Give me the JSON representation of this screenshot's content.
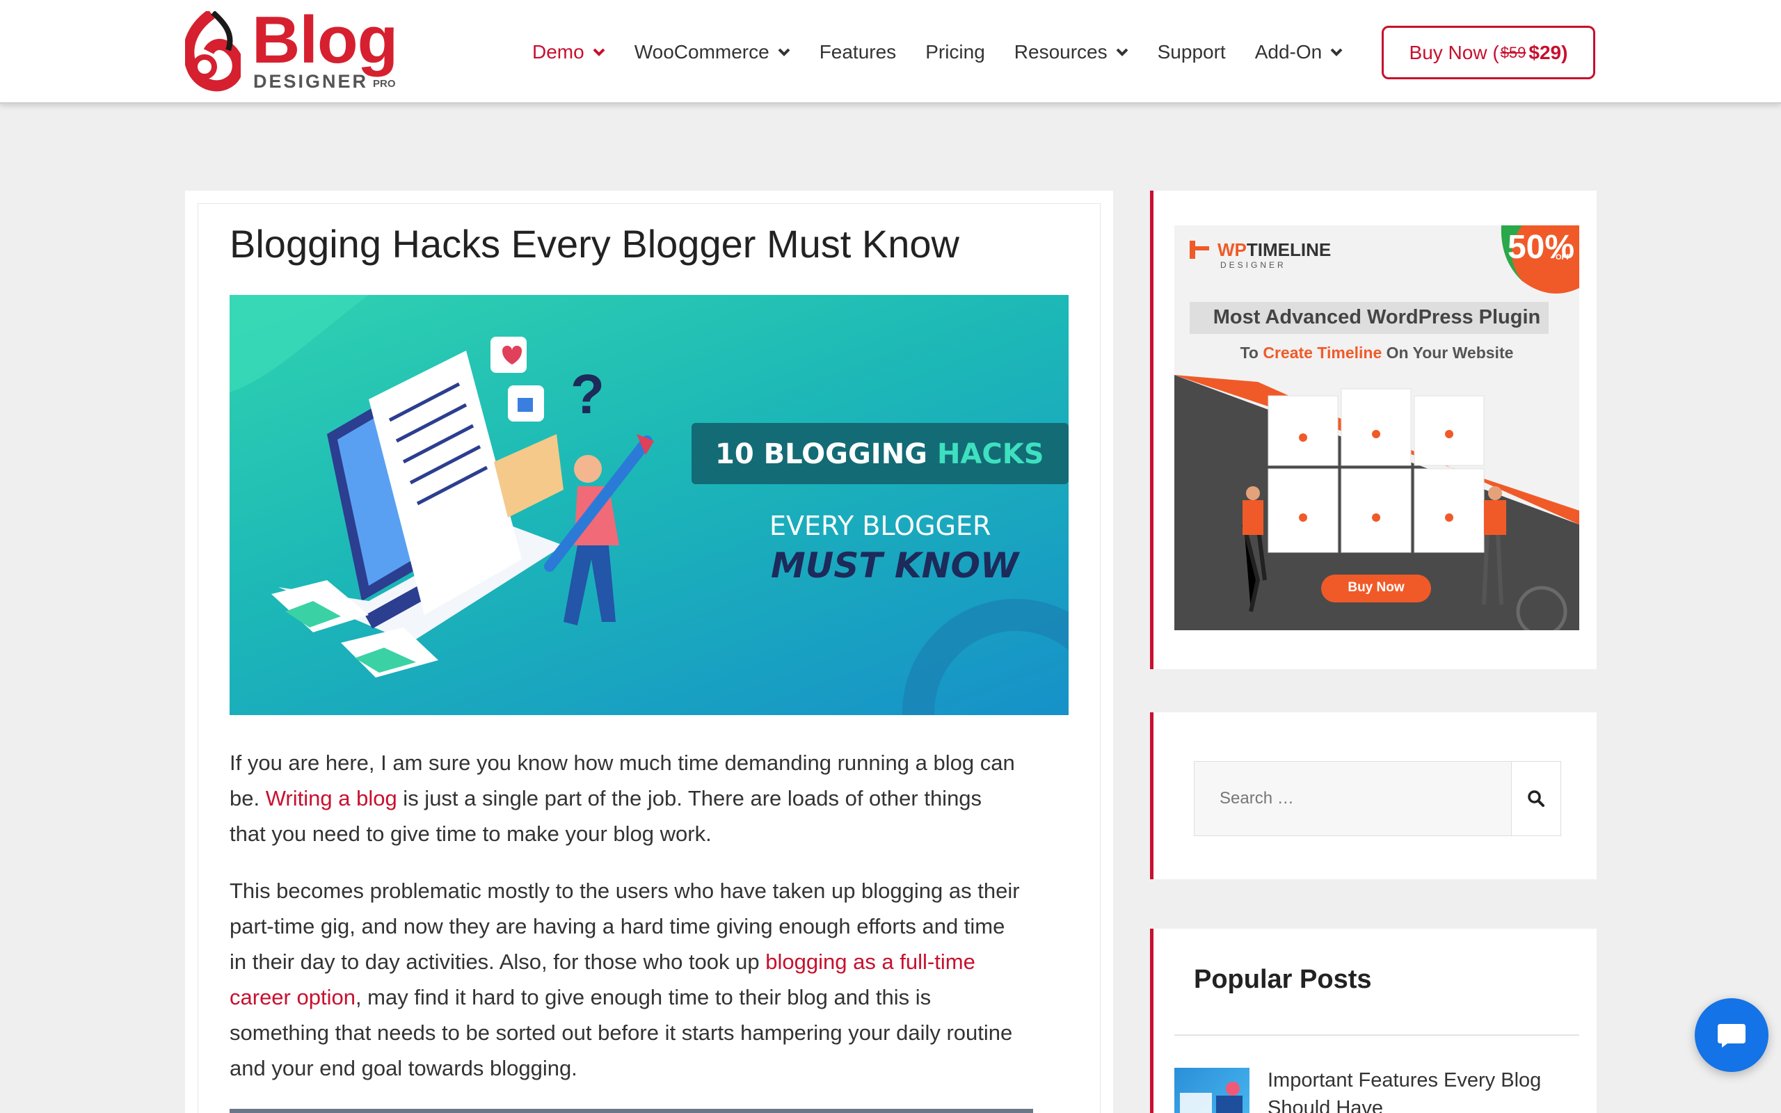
{
  "brand": {
    "logo_text": "Blog",
    "logo_sub": "DESIGNER",
    "logo_pro": "PRO"
  },
  "nav": {
    "items": [
      {
        "label": "Demo",
        "has_dropdown": true,
        "active": true
      },
      {
        "label": "WooCommerce",
        "has_dropdown": true
      },
      {
        "label": "Features",
        "has_dropdown": false
      },
      {
        "label": "Pricing",
        "has_dropdown": false
      },
      {
        "label": "Resources",
        "has_dropdown": true
      },
      {
        "label": "Support",
        "has_dropdown": false
      },
      {
        "label": "Add-On",
        "has_dropdown": true
      }
    ],
    "buy": {
      "prefix": "Buy Now (",
      "old_price": "$59",
      "new_price": "$29)"
    }
  },
  "article": {
    "title": "Blogging Hacks Every Blogger Must Know",
    "hero": {
      "line1_a": "10 BLOGGING ",
      "line1_b": "HACKS",
      "line2": "EVERY BLOGGER",
      "line3": "MUST KNOW"
    },
    "p1": {
      "before": "If you are here, I am sure you know how much time demanding running a blog can be. ",
      "link": "Writing a blog",
      "after": " is just a single part of the job. There are loads of other things that you need to give time to make your blog work."
    },
    "p2": {
      "before": "This becomes problematic mostly to the users who have taken up blogging as their part-time gig, and now they are having a hard time giving enough efforts and time in their day to day activities. Also, for those who took up ",
      "link": "blogging as a full-time career option",
      "after": ", may find it hard to give enough time to their blog and this is something that needs to be sorted out before it starts hampering your daily routine and your end goal towards blogging."
    }
  },
  "sidebar": {
    "ad": {
      "brand_a": "WP",
      "brand_b": "TIMELINE",
      "brand_sub": "DESIGNER",
      "badge": "50%",
      "badge_sub": "OFF",
      "headline": "Most Advanced WordPress Plugin",
      "sub_a": "To ",
      "sub_b": "Create Timeline",
      "sub_c": " On Your Website",
      "cta": "Buy Now"
    },
    "search": {
      "placeholder": "Search …"
    },
    "popular": {
      "title": "Popular Posts",
      "post_title": "Important Features Every Blog Should Have"
    }
  },
  "colors": {
    "accent": "#c8102e",
    "chat": "#1473e6"
  }
}
